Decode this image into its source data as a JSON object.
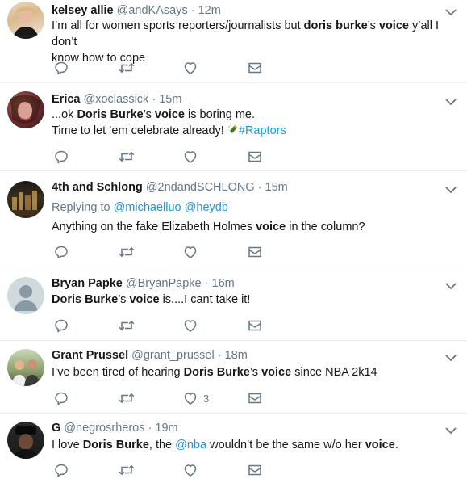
{
  "tweets": [
    {
      "name": "kelsey allie",
      "handle": "@andKAsays",
      "dot": "·",
      "time": "12m",
      "line1": {
        "a": "I’m all for women sports reporters/journalists but ",
        "b": "doris burke",
        "c": "’s ",
        "d": "voice",
        "e": " y’all I don’t"
      },
      "line2": "know how to cope"
    },
    {
      "name": "Erica",
      "handle": "@xoclassick",
      "dot": "·",
      "time": "15m",
      "line1": {
        "a": "...ok ",
        "b": "Doris Burke",
        "c": "’s ",
        "d": "voice",
        "e": " is boring me."
      },
      "line2": {
        "a": "Time to let ’em celebrate already! ",
        "tag": "#Raptors"
      }
    },
    {
      "name": "4th and Schlong",
      "handle": "@2ndandSCHLONG",
      "dot": "·",
      "time": "15m",
      "reply": {
        "label": "Replying to ",
        "u1": "@michaelluo",
        "u2": "@heydb"
      },
      "line1": {
        "a": "Anything on the fake Elizabeth Holmes ",
        "b": "voice",
        "c": " in the column?"
      }
    },
    {
      "name": "Bryan Papke",
      "handle": "@BryanPapke",
      "dot": "·",
      "time": "16m",
      "line1": {
        "a": "Doris Burke",
        "b": "’s ",
        "c": "voice",
        "d": " is....I cant take it!"
      }
    },
    {
      "name": "Grant Prussel",
      "handle": "@grant_prussel",
      "dot": "·",
      "time": "18m",
      "line1": {
        "a": "I’ve been tired of hearing ",
        "b": "Doris Burke",
        "c": "’s ",
        "d": "voice",
        "e": " since NBA 2k14"
      },
      "likes": "3"
    },
    {
      "name": "G",
      "handle": "@negrosrheros",
      "dot": "·",
      "time": "19m",
      "line1": {
        "a": "I love ",
        "b": "Doris Burke",
        "c": ", the ",
        "d": "@nba",
        "e": " wouldn’t be the same w/o her ",
        "f": "voice",
        "g": "."
      }
    }
  ],
  "icons": {
    "reply": "reply-icon",
    "retweet": "retweet-icon",
    "like": "heart-icon",
    "dm": "envelope-icon",
    "menu": "chevron-down-icon",
    "emoji": "champagne-bottle-icon"
  },
  "colors": {
    "text": "#14171a",
    "muted": "#657786",
    "link": "#1b95e0",
    "divider": "#e6ecf0"
  }
}
